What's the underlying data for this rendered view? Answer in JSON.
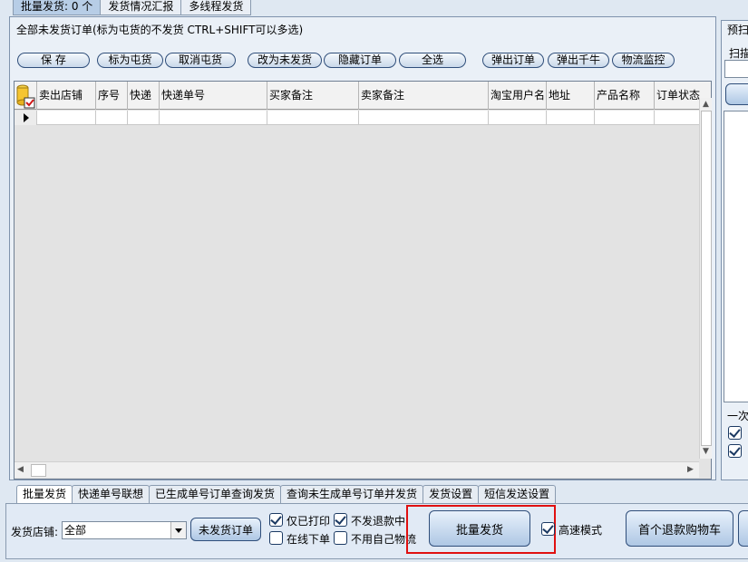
{
  "top_tabs": [
    "批量发货: 0 个",
    "发货情况汇报",
    "多线程发货"
  ],
  "panel_title": "全部未发货订单(标为屯货的不发货 CTRL+SHIFT可以多选)",
  "toolbar": [
    "保 存",
    "标为屯货",
    "取消屯货",
    "改为未发货",
    "隐藏订单",
    "全选",
    "弹出订单",
    "弹出千牛",
    "物流监控"
  ],
  "columns": [
    "卖出店铺",
    "序号",
    "快递",
    "快递单号",
    "买家备注",
    "卖家备注",
    "淘宝用户名",
    "地址",
    "产品名称",
    "订单状态"
  ],
  "right_panel": {
    "title": "预扫",
    "label": "扫描",
    "lower_text": "一次"
  },
  "bottom_tabs": [
    "批量发货",
    "快递单号联想",
    "已生成单号订单查询发货",
    "查询未生成单号订单并发货",
    "发货设置",
    "短信发送设置"
  ],
  "store": {
    "label": "发货店铺:",
    "value": "全部"
  },
  "buttons": {
    "unshipped": "未发货订单",
    "batch_ship": "批量发货",
    "refund_cart": "首个退款购物车"
  },
  "checkboxes": [
    {
      "label": "仅已打印",
      "checked": true
    },
    {
      "label": "不发退款中",
      "checked": true
    },
    {
      "label": "在线下单",
      "checked": false
    },
    {
      "label": "不用自己物流",
      "checked": false
    },
    {
      "label": "高速模式",
      "checked": true
    }
  ]
}
